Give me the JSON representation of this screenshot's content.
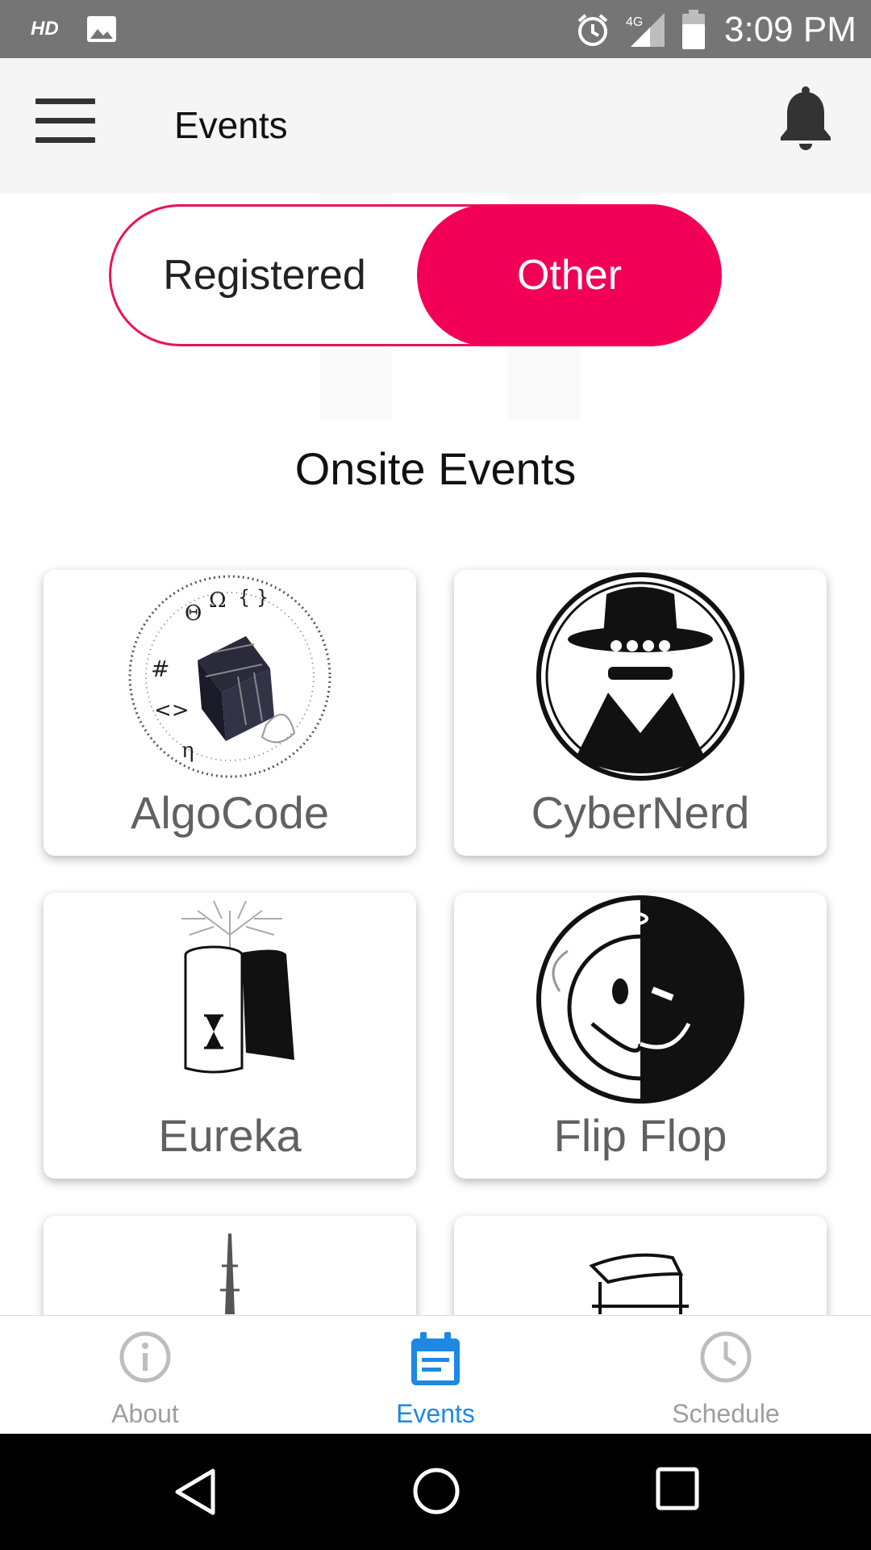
{
  "status_bar": {
    "hd_label": "HD",
    "time": "3:09 PM",
    "network": "4G",
    "icons": [
      "image-icon",
      "alarm-icon",
      "signal-icon",
      "battery-icon"
    ]
  },
  "app_bar": {
    "title": "Events",
    "menu_icon": "hamburger-menu-icon",
    "notification_icon": "bell-icon"
  },
  "toggle": {
    "options": [
      "Registered",
      "Other"
    ],
    "selected": "Other",
    "accent_color": "#f20057"
  },
  "section": {
    "title": "Onsite Events"
  },
  "events": [
    {
      "name": "AlgoCode",
      "icon": "rubiks-cube-logo"
    },
    {
      "name": "CyberNerd",
      "icon": "spy-hat-logo"
    },
    {
      "name": "Eureka",
      "icon": "hourglass-tree-logo"
    },
    {
      "name": "Flip Flop",
      "icon": "angel-devil-face-logo"
    },
    {
      "name": "",
      "icon": "tower-logo"
    },
    {
      "name": "",
      "icon": "robot-hand-logo"
    }
  ],
  "bottom_nav": {
    "items": [
      {
        "label": "About",
        "icon": "info-icon"
      },
      {
        "label": "Events",
        "icon": "calendar-icon",
        "active": true
      },
      {
        "label": "Schedule",
        "icon": "clock-icon"
      }
    ],
    "active_color": "#1e88e5"
  },
  "system_nav": [
    "back-icon",
    "home-icon",
    "recents-icon"
  ]
}
